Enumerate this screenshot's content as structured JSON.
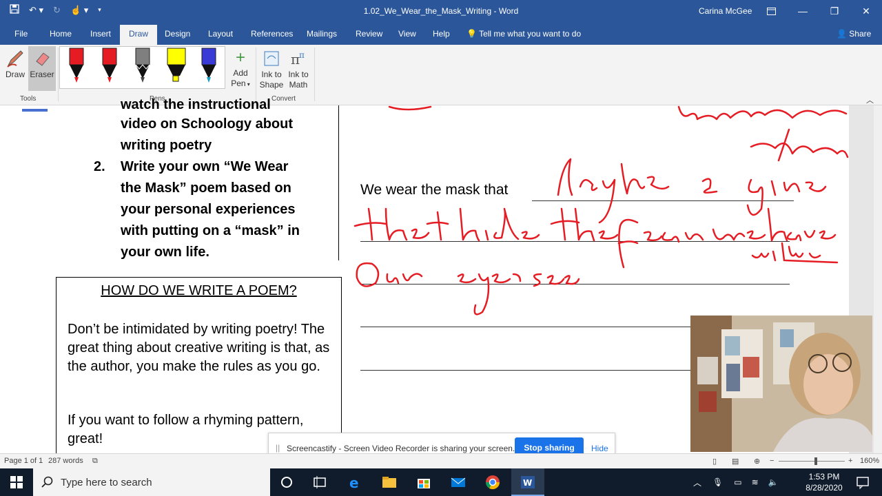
{
  "window": {
    "title": "1.02_We_Wear_the_Mask_Writing  -  Word",
    "user": "Carina McGee"
  },
  "tabs": [
    "File",
    "Home",
    "Insert",
    "Draw",
    "Design",
    "Layout",
    "References",
    "Mailings",
    "Review",
    "View",
    "Help"
  ],
  "active_tab": "Draw",
  "tell_me": "Tell me what you want to do",
  "share": "Share",
  "ribbon": {
    "draw": "Draw",
    "eraser": "Eraser",
    "tools_label": "Tools",
    "pens_label": "Pens",
    "add_pen": "Add",
    "add_pen_2": "Pen",
    "ink_to_shape_1": "Ink to",
    "ink_to_shape_2": "Shape",
    "ink_to_math_1": "Ink to",
    "ink_to_math_2": "Math",
    "convert_label": "Convert",
    "pen_colors": [
      "#e51c23",
      "#e51c23",
      "#7f7f7f",
      "#ffff00",
      "#3a3ad6"
    ]
  },
  "document": {
    "instr_lines": [
      "watch the instructional",
      "video on Schoology about",
      "writing poetry"
    ],
    "step2_num": "2.",
    "step2_lines": [
      "Write your own “We Wear",
      "the Mask” poem based on",
      "your personal experiences",
      "with putting on a “mask” in",
      "your own life."
    ],
    "how_title": "HOW DO WE WRITE A POEM?",
    "how_p1": "Don’t be intimidated by writing poetry! The great thing about creative writing is that, as the author, you make the rules as you go.",
    "how_p2": "If you want to follow a rhyming pattern, great!",
    "wear_line": "We wear the mask that"
  },
  "sharebar": {
    "message": "Screencastify - Screen Video Recorder is sharing your screen.",
    "stop": "Stop sharing",
    "hide": "Hide"
  },
  "status": {
    "page": "Page 1 of 1",
    "words": "287 words",
    "zoom": "160%"
  },
  "taskbar": {
    "search_placeholder": "Type here to search",
    "time": "1:53 PM",
    "date": "8/28/2020"
  }
}
